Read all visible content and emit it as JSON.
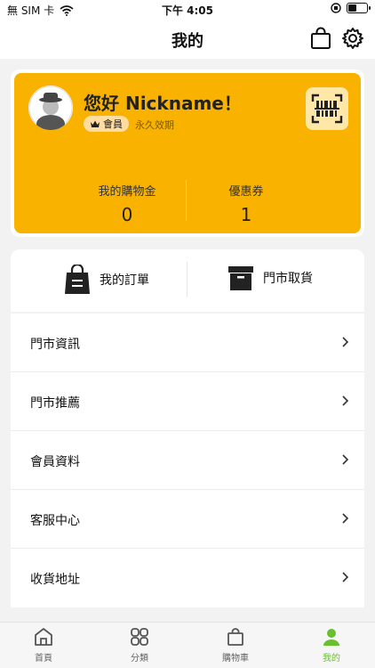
{
  "status_bar": {
    "carrier": "無 SIM 卡",
    "time": "下午 4:05"
  },
  "header": {
    "title": "我的"
  },
  "profile": {
    "greeting": "您好 Nickname！",
    "member_badge": "會員",
    "validity": "永久效期",
    "stats": [
      {
        "label": "我的購物金",
        "value": "0"
      },
      {
        "label": "優惠券",
        "value": "1"
      }
    ]
  },
  "quick_actions": [
    {
      "label": "我的訂單",
      "icon": "bag-list-icon"
    },
    {
      "label": "門市取貨",
      "icon": "store-box-icon"
    }
  ],
  "menu": [
    {
      "label": "門市資訊"
    },
    {
      "label": "門市推薦"
    },
    {
      "label": "會員資料"
    },
    {
      "label": "客服中心"
    },
    {
      "label": "收貨地址"
    }
  ],
  "tabs": [
    {
      "label": "首頁",
      "icon": "home-icon",
      "active": false
    },
    {
      "label": "分類",
      "icon": "grid-icon",
      "active": false
    },
    {
      "label": "購物車",
      "icon": "cart-bag-icon",
      "active": false
    },
    {
      "label": "我的",
      "icon": "person-icon",
      "active": true
    }
  ],
  "colors": {
    "accent": "#f9b200",
    "active_tab": "#6abf2e"
  }
}
